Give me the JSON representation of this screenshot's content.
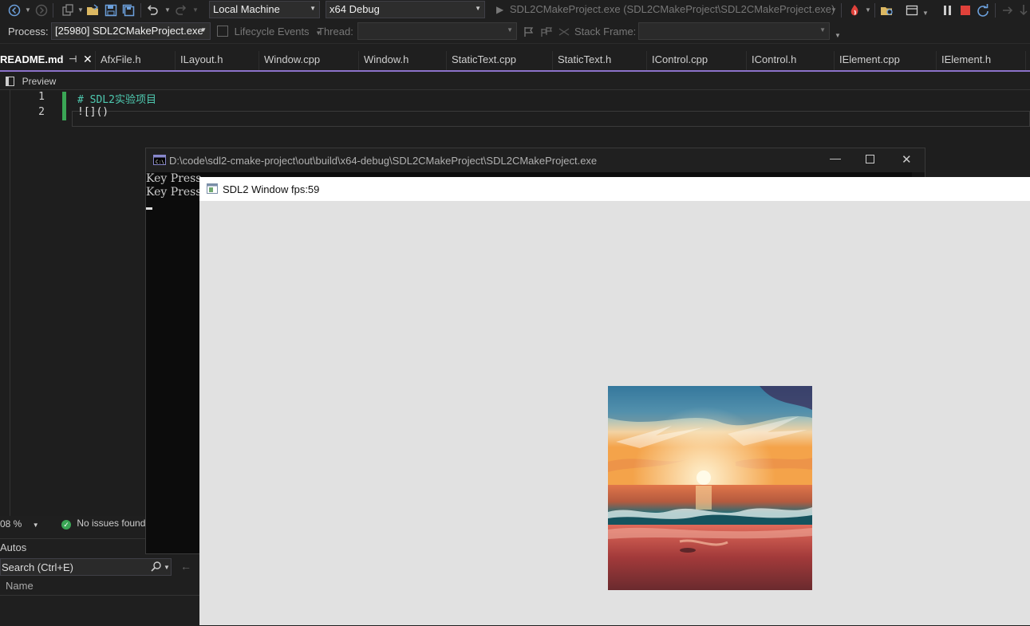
{
  "toolbar": {
    "target_select": "Local Machine",
    "config_select": "x64 Debug",
    "run_label": "SDL2CMakeProject.exe (SDL2CMakeProject\\SDL2CMakeProject.exe)"
  },
  "debug_bar": {
    "process_label": "Process:",
    "process_value": "[25980] SDL2CMakeProject.exe",
    "lifecycle_label": "Lifecycle Events",
    "thread_label": "Thread:",
    "thread_value": "",
    "stack_frame_label": "Stack Frame:",
    "stack_frame_value": ""
  },
  "tabs": [
    {
      "label": "README.md",
      "active": true
    },
    {
      "label": "AfxFile.h"
    },
    {
      "label": "ILayout.h"
    },
    {
      "label": "Window.cpp"
    },
    {
      "label": "Window.h"
    },
    {
      "label": "StaticText.cpp"
    },
    {
      "label": "StaticText.h"
    },
    {
      "label": "IControl.cpp"
    },
    {
      "label": "IControl.h"
    },
    {
      "label": "IElement.cpp"
    },
    {
      "label": "IElement.h"
    }
  ],
  "preview": {
    "label": "Preview"
  },
  "editor": {
    "lines": [
      {
        "number": "1",
        "text": "# SDL2实验项目"
      },
      {
        "number": "2",
        "text": "![]()"
      }
    ]
  },
  "status": {
    "zoom": "08 %",
    "issues": "No issues found"
  },
  "autos": {
    "title": "Autos",
    "search_placeholder": "Search (Ctrl+E)",
    "col_name": "Name"
  },
  "console": {
    "title": "D:\\code\\sdl2-cmake-project\\out\\build\\x64-debug\\SDL2CMakeProject\\SDL2CMakeProject.exe",
    "lines": [
      "Key Press",
      "Key Press"
    ]
  },
  "sdl_window": {
    "title": "SDL2 Window fps:59"
  },
  "colors": {
    "accent": "#8b72c9",
    "heading_green": "#4ec9b0",
    "change_bar": "#3aa655"
  },
  "icons": [
    "back-icon",
    "forward-icon",
    "new-project-icon",
    "open-folder-icon",
    "save-icon",
    "save-all-icon",
    "undo-icon",
    "redo-icon",
    "start-icon",
    "hot-reload-icon",
    "solution-explorer-icon",
    "pause-icon",
    "stop-icon",
    "restart-icon",
    "flag-icon",
    "threads-icon",
    "pin-icon",
    "close-icon",
    "preview-icon",
    "check-icon",
    "search-icon",
    "console-app-icon",
    "sdl-app-icon",
    "minimize-icon",
    "maximize-icon"
  ]
}
